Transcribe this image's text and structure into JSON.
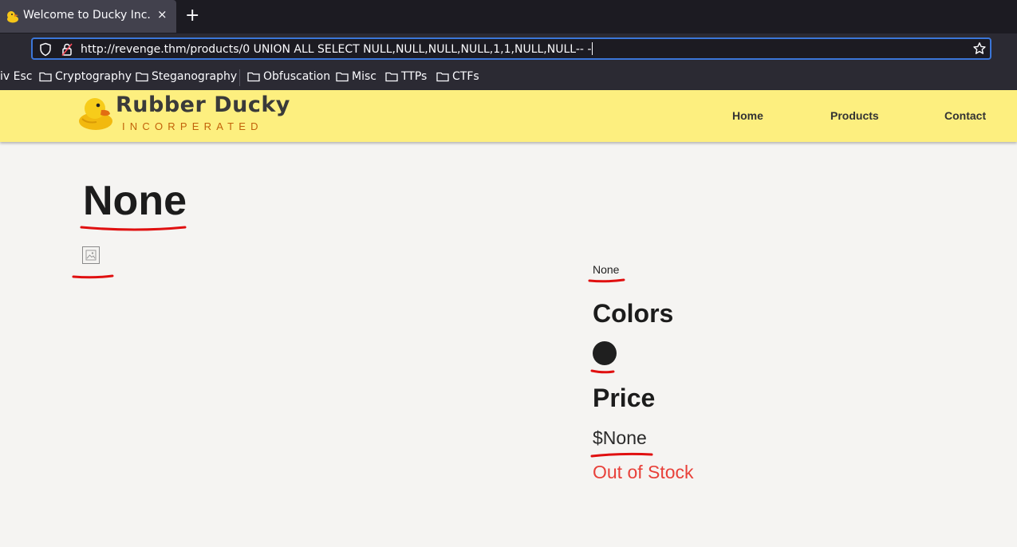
{
  "browser": {
    "tab_title": "Welcome to Ducky Inc.",
    "tab_close": "×",
    "new_tab": "+",
    "url": "http://revenge.thm/products/0 UNION ALL SELECT NULL,NULL,NULL,NULL,1,1,NULL,NULL-- -",
    "bookmarks": [
      "iv Esc",
      "Cryptography",
      "Steganography",
      "Obfuscation",
      "Misc",
      "TTPs",
      "CTFs"
    ]
  },
  "site": {
    "logo_name": "Rubber Ducky",
    "logo_sub": "INCORPERATED",
    "nav": [
      "Home",
      "Products",
      "Contact"
    ]
  },
  "product": {
    "title": "None",
    "description": "None",
    "colors_heading": "Colors",
    "price_heading": "Price",
    "price": "$None",
    "stock_status": "Out of Stock"
  },
  "colors": {
    "header_bg": "#fdef7f",
    "stock_red": "#e8413a",
    "annotation_red": "#e01010",
    "swatch": "#1f1f1f"
  }
}
